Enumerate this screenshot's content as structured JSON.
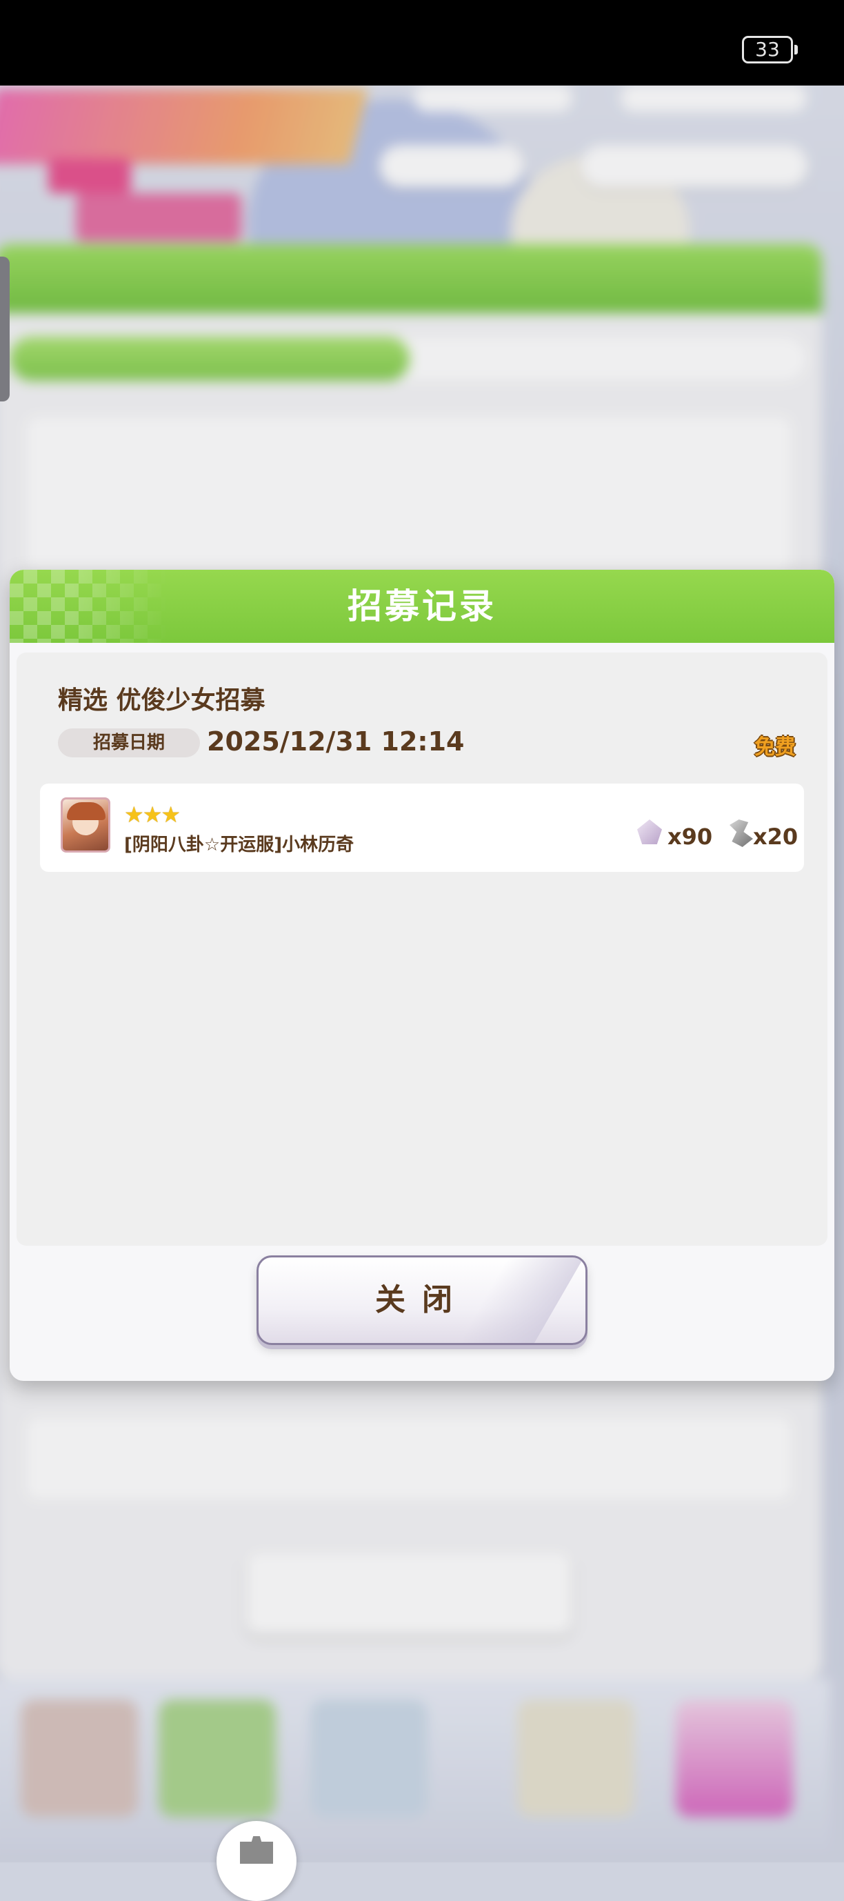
{
  "status_bar": {
    "battery": "33"
  },
  "modal": {
    "title": "招募记录",
    "record_title": "精选 优俊少女招募",
    "date_label": "招募日期",
    "date_value": "2025/12/31 12:14",
    "cost_badge": "免费",
    "result": {
      "stars": "★★★",
      "rarity": 3,
      "character_name": "[阴阳八卦☆开运服]小林历奇",
      "reward_1": "x90",
      "reward_2": "x20",
      "reward_1_icon": "character-piece-icon",
      "reward_2_icon": "hammer-material-icon"
    },
    "close_label": "关闭"
  },
  "colors": {
    "header_green": "#7cc83c",
    "text_brown": "#5a3a1e",
    "free_gold": "#f0a020",
    "star_gold": "#f6c21a"
  }
}
